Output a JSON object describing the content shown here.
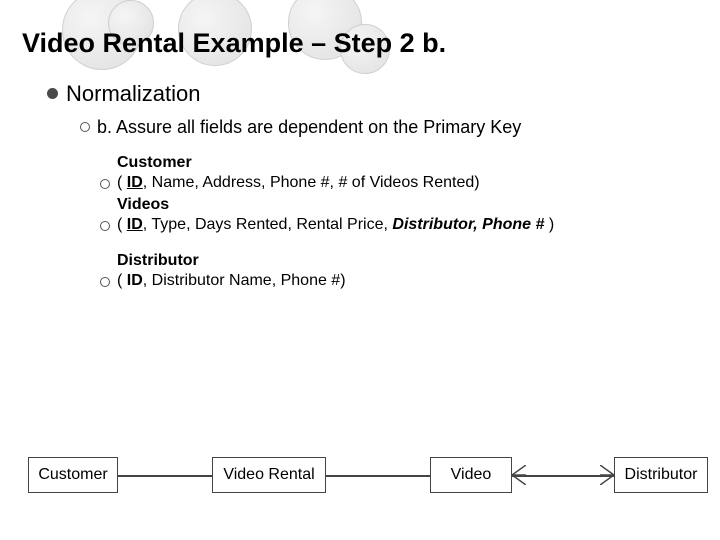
{
  "title": "Video Rental Example – Step 2 b.",
  "lvl1": {
    "text": "Normalization"
  },
  "lvl2": {
    "text": "b. Assure all fields are dependent on the Primary Key"
  },
  "tables": {
    "customer": {
      "name": "Customer",
      "open": "( ",
      "pk": "ID",
      "rest": ", Name, Address, Phone #, # of Videos Rented)"
    },
    "videos": {
      "name": "Videos",
      "open": "( ",
      "pk": "ID",
      "mid": ", Type, Days Rented, Rental Price, ",
      "fk": "Distributor, Phone #",
      "close": " )"
    },
    "distributor": {
      "name": "Distributor",
      "open": "( ",
      "pk": "ID",
      "rest": ", Distributor Name, Phone #)"
    }
  },
  "entities": {
    "e1": "Customer",
    "e2": "Video Rental",
    "e3": "Video",
    "e4": "Distributor"
  }
}
